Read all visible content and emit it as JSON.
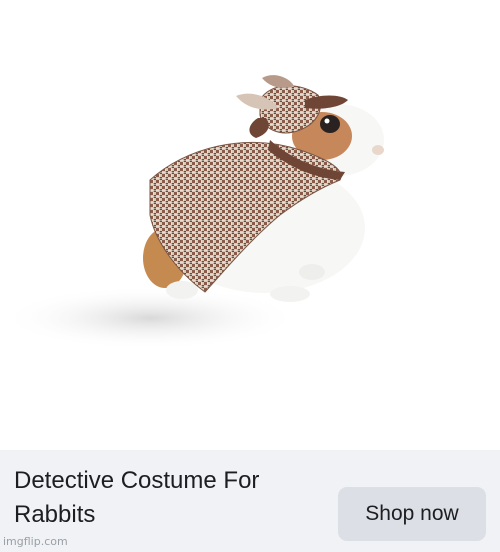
{
  "ad": {
    "title": "Detective Costume For Rabbits",
    "cta_label": "Shop now",
    "image_subject": "rabbit-in-detective-costume-image"
  },
  "watermark": {
    "text": "imgflip.com"
  },
  "colors": {
    "footer_background": "#f0f2f5",
    "button_background": "#dcdfe5",
    "text": "#1c1e21",
    "watermark": "#9aa0a6"
  }
}
